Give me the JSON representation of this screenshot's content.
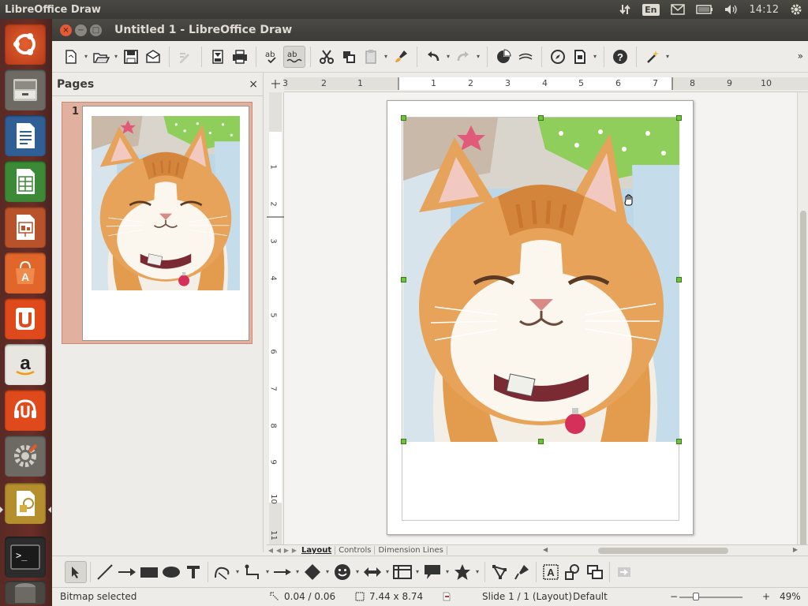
{
  "top_panel": {
    "app_title": "LibreOffice Draw",
    "keyboard_layout": "En",
    "clock": "14:12"
  },
  "launcher": {
    "items": [
      {
        "name": "ubuntu-dash",
        "icon": "ubuntu-logo-icon"
      },
      {
        "name": "files",
        "icon": "file-manager-icon"
      },
      {
        "name": "writer",
        "icon": "libreoffice-writer-icon"
      },
      {
        "name": "calc",
        "icon": "libreoffice-calc-icon"
      },
      {
        "name": "impress",
        "icon": "libreoffice-impress-icon"
      },
      {
        "name": "software-center",
        "icon": "software-center-icon"
      },
      {
        "name": "ubuntu-one",
        "icon": "ubuntu-one-icon"
      },
      {
        "name": "amazon",
        "icon": "amazon-icon"
      },
      {
        "name": "ubuntu-one-music",
        "icon": "ubuntu-one-music-icon"
      },
      {
        "name": "system-settings",
        "icon": "settings-icon"
      },
      {
        "name": "libreoffice-draw",
        "icon": "libreoffice-draw-icon"
      },
      {
        "name": "terminal",
        "icon": "terminal-icon"
      },
      {
        "name": "trash",
        "icon": "trash-icon"
      }
    ]
  },
  "window": {
    "title": "Untitled 1 - LibreOffice Draw"
  },
  "pages_panel": {
    "title": "Pages",
    "close_label": "×",
    "pages": [
      {
        "number": "1"
      }
    ]
  },
  "hruler": {
    "labels": [
      "3",
      "2",
      "1",
      "1",
      "2",
      "3",
      "4",
      "5",
      "6",
      "7",
      "8",
      "9",
      "10"
    ]
  },
  "vruler": {
    "labels": [
      "1",
      "2",
      "3",
      "4",
      "5",
      "6",
      "7",
      "8",
      "9",
      "10",
      "11"
    ]
  },
  "tabs": [
    {
      "label": "Layout",
      "active": true
    },
    {
      "label": "Controls",
      "active": false
    },
    {
      "label": "Dimension Lines",
      "active": false
    }
  ],
  "status": {
    "message": "Bitmap selected",
    "position": "0.04 / 0.06",
    "size": "7.44 x 8.74",
    "slide": "Slide 1 / 1 (Layout)",
    "master": "Default",
    "zoom": "49%",
    "zoom_minus": "−",
    "zoom_plus": "+"
  },
  "colors": {
    "selection_handle": "#6ec23a",
    "page_thumb_highlight": "#e2b09e",
    "launcher_bg": "#5a2a24"
  }
}
